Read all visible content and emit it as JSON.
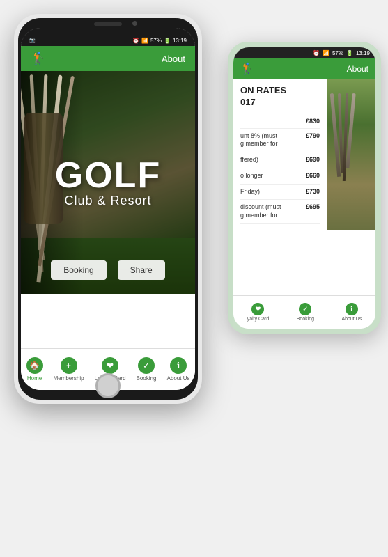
{
  "scene": {
    "background": "#f0f0f0"
  },
  "back_phone": {
    "status_bar": {
      "alarm": "⏰",
      "wifi": "📶",
      "signal": "57%",
      "battery": "🔋",
      "time": "13:19"
    },
    "header": {
      "golfer_icon": "🏌",
      "title": "About"
    },
    "rates_title_line1": "ON RATES",
    "rates_title_line2": "017",
    "rates": [
      {
        "label": "",
        "price": "£830"
      },
      {
        "label": "unt 8% (must\ng member for",
        "price": "£790"
      },
      {
        "label": "ffered)",
        "price": "£690"
      },
      {
        "label": "o longer",
        "price": "£660"
      },
      {
        "label": "Friday)",
        "price": "£730"
      },
      {
        "label": "discount (must\ng member for",
        "price": "£695"
      }
    ],
    "bottom_nav": [
      {
        "label": "yalty Card",
        "icon": "❤"
      },
      {
        "label": "Booking",
        "icon": "✓"
      },
      {
        "label": "About Us",
        "icon": "ℹ"
      }
    ]
  },
  "front_phone": {
    "status_bar": {
      "camera_icon": "📷",
      "alarm": "⏰",
      "wifi": "📶",
      "signal": "57%",
      "battery": "🔋",
      "time": "13:19"
    },
    "header": {
      "golfer_icon": "🏌",
      "title": "About"
    },
    "hero": {
      "title": "GOLF",
      "subtitle": "Club & Resort"
    },
    "buttons": [
      {
        "label": "Booking"
      },
      {
        "label": "Share"
      }
    ],
    "bottom_nav": [
      {
        "label": "Home",
        "icon": "🏠",
        "active": true
      },
      {
        "label": "Membership",
        "icon": "+"
      },
      {
        "label": "Loyalty Card",
        "icon": "❤"
      },
      {
        "label": "Booking",
        "icon": "✓"
      },
      {
        "label": "About Us",
        "icon": "ℹ"
      }
    ]
  }
}
